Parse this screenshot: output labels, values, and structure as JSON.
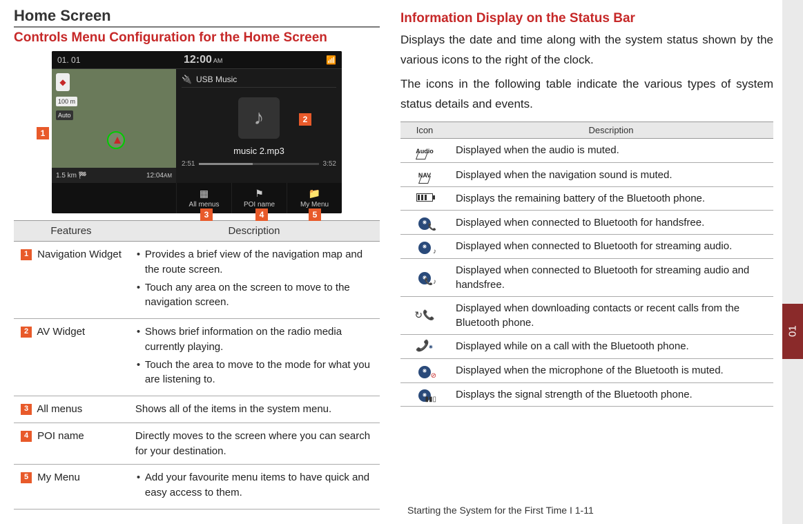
{
  "left": {
    "section_title": "Home Screen",
    "subtitle": "Controls Menu Configuration for the Home Screen",
    "screenshot": {
      "status_date": "01. 01",
      "status_time": "12:00",
      "status_ampm": "AM",
      "nav_scale": "100 m",
      "nav_auto": "Auto",
      "nav_dist": "1.5 km",
      "nav_time": "12:04",
      "nav_ampm": "AM",
      "av_source": "USB Music",
      "av_track": "music 2.mp3",
      "av_elapsed": "2:51",
      "av_total": "3:52",
      "menu1": "All menus",
      "menu2": "POI name",
      "menu3": "My Menu"
    },
    "features_table": {
      "head_features": "Features",
      "head_description": "Description",
      "rows": [
        {
          "num": "1",
          "name": "Navigation Widget",
          "bullets": [
            "Provides a brief view of the navigation map and the route screen.",
            "Touch any area on the screen to move to the navigation screen."
          ]
        },
        {
          "num": "2",
          "name": "AV Widget",
          "bullets": [
            "Shows brief information on the radio media currently playing.",
            "Touch the area to move to the mode for what you are listening to."
          ]
        },
        {
          "num": "3",
          "name": "All menus",
          "text": "Shows all of the items in the system menu."
        },
        {
          "num": "4",
          "name": "POI name",
          "text": "Directly moves to the screen where you can search for your destination."
        },
        {
          "num": "5",
          "name": "My Menu",
          "bullets": [
            "Add your favourite menu items to have quick and easy access to them."
          ]
        }
      ]
    }
  },
  "right": {
    "title": "Information Display on the Status Bar",
    "para1": "Displays the date and time along with the system status shown by the various icons to the right of the clock.",
    "para2": "The icons in the following table indicate the various types of system status details and events.",
    "icon_table": {
      "head_icon": "Icon",
      "head_desc": "Description",
      "rows": [
        {
          "icon": "audio-mute",
          "desc": "Displayed when the audio is muted."
        },
        {
          "icon": "nav-mute",
          "desc": "Displayed when the navigation sound is muted."
        },
        {
          "icon": "battery",
          "desc": "Displays the remaining battery of the Bluetooth phone."
        },
        {
          "icon": "bt-handsfree",
          "desc": "Displayed when connected to Bluetooth for handsfree."
        },
        {
          "icon": "bt-audio",
          "desc": "Displayed when connected to Bluetooth for streaming audio."
        },
        {
          "icon": "bt-both",
          "desc": "Displayed when connected to Bluetooth for streaming audio and handsfree."
        },
        {
          "icon": "bt-download",
          "desc": "Displayed when downloading contacts or recent calls from the Bluetooth phone."
        },
        {
          "icon": "bt-call",
          "desc": "Displayed while on a call with the Bluetooth phone."
        },
        {
          "icon": "bt-mic-mute",
          "desc": "Displayed when the microphone of the Bluetooth is muted."
        },
        {
          "icon": "bt-signal",
          "desc": "Displays the signal strength of the Bluetooth phone."
        }
      ]
    }
  },
  "footer": "Starting the System for the First Time I 1-11",
  "side_tab": "01"
}
